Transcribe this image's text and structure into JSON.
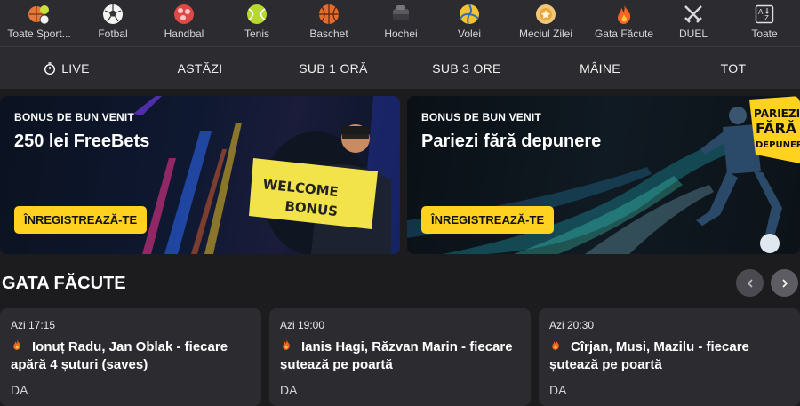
{
  "sports": [
    {
      "label": "Toate Sport...",
      "icon": "all-sports-icon"
    },
    {
      "label": "Fotbal",
      "icon": "football-icon"
    },
    {
      "label": "Handbal",
      "icon": "handball-icon"
    },
    {
      "label": "Tenis",
      "icon": "tennis-icon"
    },
    {
      "label": "Baschet",
      "icon": "basketball-icon"
    },
    {
      "label": "Hochei",
      "icon": "hockey-icon"
    },
    {
      "label": "Volei",
      "icon": "volleyball-icon"
    },
    {
      "label": "Meciul Zilei",
      "icon": "match-of-day-icon"
    },
    {
      "label": "Gata Făcute",
      "icon": "fire-icon"
    },
    {
      "label": "DUEL",
      "icon": "swords-icon"
    },
    {
      "label": "Toate",
      "icon": "az-sort-icon"
    }
  ],
  "time_filters": [
    "LIVE",
    "ASTĂZI",
    "SUB 1 ORĂ",
    "SUB 3 ORE",
    "MÂINE",
    "TOT"
  ],
  "banners": [
    {
      "kicker": "BONUS DE BUN VENIT",
      "title": "250 lei FreeBets",
      "button": "ÎNREGISTREAZĂ-TE",
      "sign_line1": "WELCOME",
      "sign_line2": "BONUS"
    },
    {
      "kicker": "BONUS DE BUN VENIT",
      "title": "Pariezi fără depunere",
      "button": "ÎNREGISTREAZĂ-TE",
      "badge_line1": "PARIEZI",
      "badge_line2": "FĂRĂ",
      "badge_line3": "DEPUNERE"
    }
  ],
  "section": {
    "title": "GATA FĂCUTE"
  },
  "cards": [
    {
      "time": "Azi 17:15",
      "title": "Ionuț Radu, Jan Oblak - fiecare apără 4 șuturi (saves)",
      "answer": "DA"
    },
    {
      "time": "Azi 19:00",
      "title": "Ianis Hagi, Răzvan Marin - fiecare șutează pe poartă",
      "answer": "DA"
    },
    {
      "time": "Azi 20:30",
      "title": "Cîrjan, Musi, Mazilu - fiecare șutează pe poartă",
      "answer": "DA"
    }
  ],
  "colors": {
    "accent": "#ffd21f",
    "bar": "#2b2b30",
    "bg": "#1c1c1f",
    "fire": "#f26522"
  }
}
